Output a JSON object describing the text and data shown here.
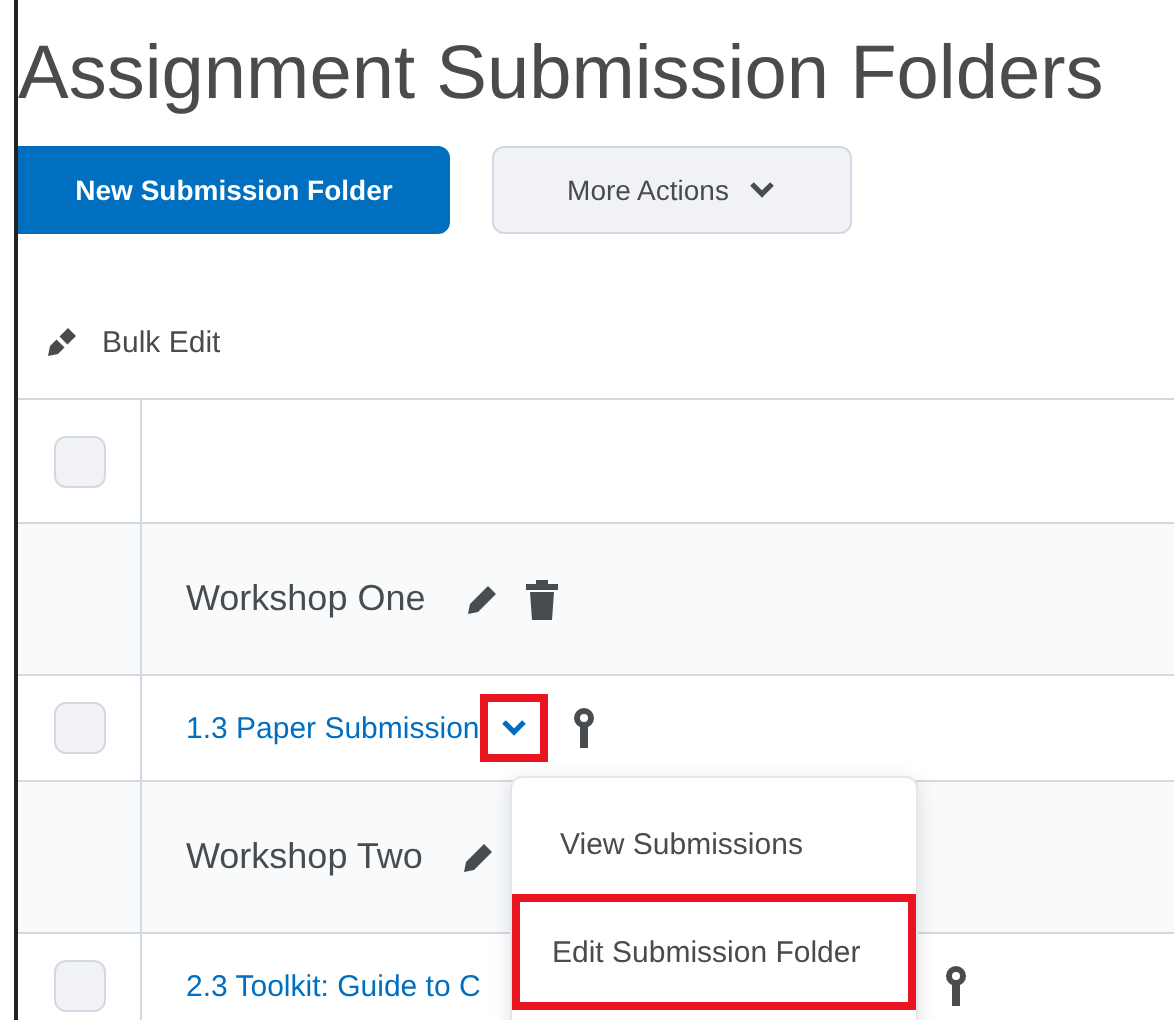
{
  "title": "Assignment Submission Folders",
  "buttons": [
    {
      "label": "New Submission Folder",
      "kind": "primary"
    },
    {
      "label": "More Actions",
      "kind": "menu"
    }
  ],
  "bulk_edit": "Bulk Edit",
  "table": {
    "header_checkbox": {
      "checked": false
    },
    "rows": [
      {
        "kind": "group",
        "name": "Workshop One",
        "edit_icon": true,
        "delete_icon": true
      },
      {
        "kind": "item",
        "name": "1.3 Paper Submission",
        "checked": false,
        "highlighted": true
      },
      {
        "kind": "group",
        "name": "Workshop Two",
        "edit_icon": true,
        "delete_icon": false
      },
      {
        "kind": "item",
        "name": "2.3 Toolkit: Guide to C",
        "checked": false,
        "highlighted": false
      }
    ]
  },
  "context_menu": {
    "items": [
      {
        "label": "View Submissions",
        "highlighted": false
      },
      {
        "label": "Edit Submission Folder",
        "highlighted": true
      }
    ]
  }
}
